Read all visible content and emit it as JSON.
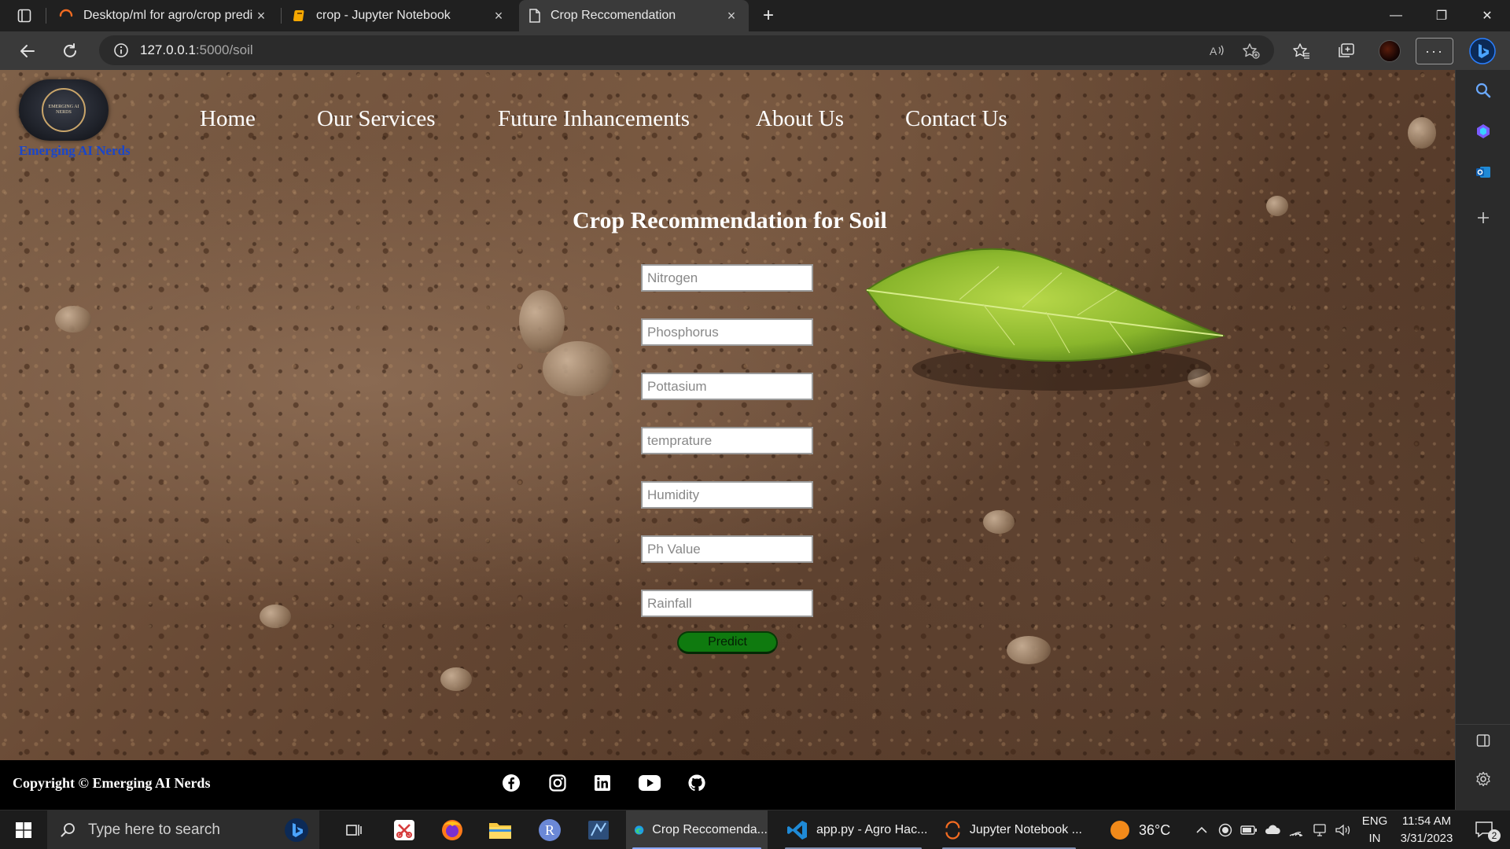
{
  "browser": {
    "tabs": [
      {
        "title": "Desktop/ml for agro/crop predic",
        "close": "×"
      },
      {
        "title": "crop - Jupyter Notebook",
        "close": "×"
      },
      {
        "title": "Crop Reccomendation",
        "close": "×"
      }
    ],
    "new_tab": "+",
    "window_controls": {
      "minimize": "—",
      "maximize": "❐",
      "close": "✕"
    },
    "url_host": "127.0.0.1",
    "url_path": ":5000/soil",
    "more_menu": "···"
  },
  "page": {
    "logo_text": "EMERGING AI NERDS",
    "brand": "Emerging AI Nerds",
    "nav": [
      "Home",
      "Our Services",
      "Future Inhancements",
      "About Us",
      "Contact Us"
    ],
    "form_title": "Crop Recommendation for Soil",
    "fields": [
      {
        "placeholder": "Nitrogen"
      },
      {
        "placeholder": "Phosphorus"
      },
      {
        "placeholder": "Pottasium"
      },
      {
        "placeholder": "temprature"
      },
      {
        "placeholder": "Humidity"
      },
      {
        "placeholder": "Ph Value"
      },
      {
        "placeholder": "Rainfall"
      }
    ],
    "predict_label": "Predict",
    "footer": {
      "copyright": "Copyright © Emerging AI Nerds",
      "social_icons": [
        "facebook-icon",
        "instagram-icon",
        "linkedin-icon",
        "youtube-icon",
        "github-icon"
      ]
    }
  },
  "taskbar": {
    "search_placeholder": "Type here to search",
    "apps": [
      {
        "label": "Crop Reccomenda...",
        "icon": "edge-icon"
      },
      {
        "label": "app.py - Agro Hac...",
        "icon": "vscode-icon"
      },
      {
        "label": "Jupyter Notebook ...",
        "icon": "jupyter-icon"
      }
    ],
    "weather": "36°C",
    "language": [
      "ENG",
      "IN"
    ],
    "time": "11:54 AM",
    "date": "3/31/2023",
    "notifications": "2"
  },
  "colors": {
    "brand_text": "#1a46c9",
    "predict_button": "#0f7a0f",
    "footer_bg": "#000000",
    "taskbar_accent": "#8aa8ff"
  }
}
